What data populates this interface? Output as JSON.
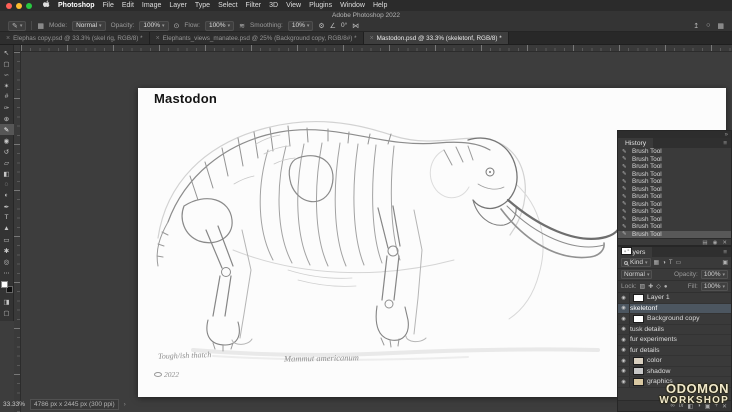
{
  "menubar": {
    "app": "Photoshop",
    "items": [
      "File",
      "Edit",
      "Image",
      "Layer",
      "Type",
      "Select",
      "Filter",
      "3D",
      "View",
      "Plugins",
      "Window",
      "Help"
    ]
  },
  "titlebar": {
    "title": "Adobe Photoshop 2022"
  },
  "options": {
    "mode_label": "Mode:",
    "mode_value": "Normal",
    "opacity_label": "Opacity:",
    "opacity_value": "100%",
    "flow_label": "Flow:",
    "flow_value": "100%",
    "smoothing_label": "Smoothing:",
    "smoothing_value": "10%",
    "angle_value": "0°"
  },
  "tabs": [
    {
      "close": "×",
      "label": "Elephas copy.psd @ 33.3% (skel rig, RGB/8) *"
    },
    {
      "close": "×",
      "label": "Elephants_views_manatee.psd @ 25% (Background copy, RGB/8#) *"
    },
    {
      "close": "×",
      "label": "Mastodon.psd @ 33.3% (skeletonf, RGB/8) *"
    }
  ],
  "tools": [
    {
      "name": "move",
      "glyph": "↖"
    },
    {
      "name": "marquee",
      "glyph": "▢"
    },
    {
      "name": "lasso",
      "glyph": "∽"
    },
    {
      "name": "object-selection",
      "glyph": "✶"
    },
    {
      "name": "crop",
      "glyph": "#"
    },
    {
      "name": "eyedropper",
      "glyph": "✑"
    },
    {
      "name": "healing",
      "glyph": "⊕"
    },
    {
      "name": "brush",
      "glyph": "✎"
    },
    {
      "name": "clone-stamp",
      "glyph": "◉"
    },
    {
      "name": "history-brush",
      "glyph": "↺"
    },
    {
      "name": "eraser",
      "glyph": "▱"
    },
    {
      "name": "gradient",
      "glyph": "◧"
    },
    {
      "name": "blur",
      "glyph": "◌"
    },
    {
      "name": "dodge",
      "glyph": "◐"
    },
    {
      "name": "pen",
      "glyph": "✒"
    },
    {
      "name": "type",
      "glyph": "T"
    },
    {
      "name": "path-selection",
      "glyph": "▲"
    },
    {
      "name": "shape",
      "glyph": "▭"
    },
    {
      "name": "hand",
      "glyph": "✱"
    },
    {
      "name": "zoom",
      "glyph": "◎"
    }
  ],
  "icons": {
    "caret_down": "▾",
    "panel_menu": "≡",
    "collapse": "»",
    "eye": "◉",
    "ellipsis": "⋯",
    "search": "○",
    "workspace": "▦",
    "share": "↥",
    "gear": "⚙",
    "angle": "∠",
    "airbrush": "≋",
    "pen_pressure": "⊙",
    "symmetry": "⋈",
    "quick_mask": "◨",
    "screen_mode": "▢",
    "brush_tip": "✎",
    "new_doc_from_state": "▤",
    "snapshot_camera": "◉",
    "trash": "✕",
    "link": "∞",
    "fx": "fx",
    "mask": "◧",
    "adjustment": "◑",
    "group": "▣",
    "new_layer": "+",
    "filter_pixel": "▦",
    "filter_adjustment": "◑",
    "filter_type": "T",
    "filter_shape": "▭",
    "filter_smart": "▣",
    "lock_transparency": "▨",
    "lock_pixels": "✚",
    "lock_position": "◇",
    "lock_all": "●",
    "chevron": "›"
  },
  "canvas": {
    "doc_title": "Mastodon",
    "caption_note": "Tough/ish thatch",
    "caption_species": "Mammut americanum",
    "caption_year": "2022"
  },
  "history": {
    "title": "History",
    "entries": [
      "Brush Tool",
      "Brush Tool",
      "Brush Tool",
      "Brush Tool",
      "Brush Tool",
      "Brush Tool",
      "Brush Tool",
      "Brush Tool",
      "Brush Tool",
      "Brush Tool",
      "Brush Tool",
      "Brush Tool"
    ]
  },
  "layers": {
    "title": "Layers",
    "kind_label": "Kind",
    "blend_mode": "Normal",
    "opacity_label": "Opacity:",
    "opacity_value": "100%",
    "lock_label": "Lock:",
    "fill_label": "Fill:",
    "fill_value": "100%",
    "items": [
      {
        "name": "Layer 1"
      },
      {
        "name": "skeletonf"
      },
      {
        "name": "Background copy"
      },
      {
        "name": "tusk details"
      },
      {
        "name": "fur experiments"
      },
      {
        "name": "fur details"
      },
      {
        "name": "color"
      },
      {
        "name": "shadow"
      },
      {
        "name": "graphics"
      }
    ]
  },
  "statusbar": {
    "zoom": "33.33%",
    "doc_info": "4786 px x 2445 px (300 ppi)"
  },
  "watermark": {
    "line1": "ODOMON",
    "line2": "WORKSHOP"
  },
  "colors": {
    "selected_layer": "#4c5660",
    "accent_red": "#ff5f57",
    "accent_yellow": "#febc2e",
    "accent_green": "#28c840"
  }
}
